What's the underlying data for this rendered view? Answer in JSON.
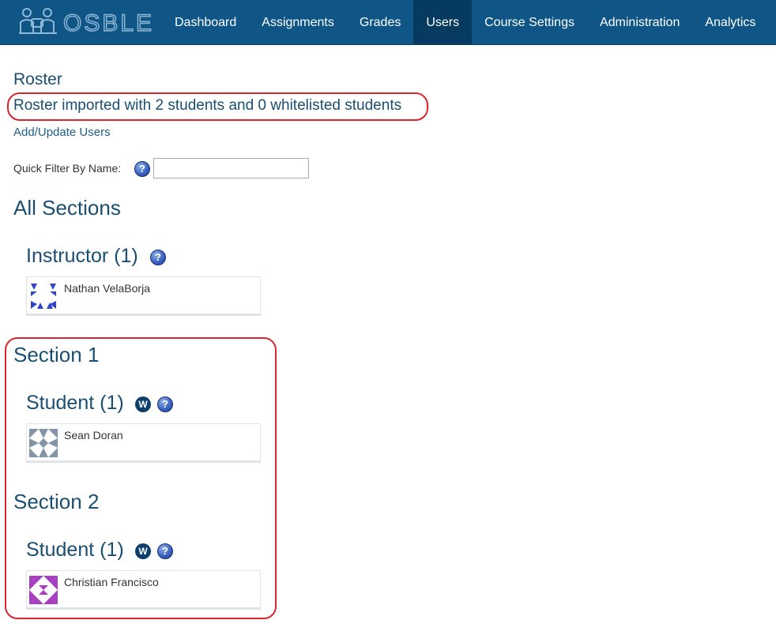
{
  "app": {
    "logo_text": "OSBLE"
  },
  "nav": {
    "items": [
      {
        "label": "Dashboard"
      },
      {
        "label": "Assignments"
      },
      {
        "label": "Grades"
      },
      {
        "label": "Users"
      },
      {
        "label": "Course Settings"
      },
      {
        "label": "Administration"
      },
      {
        "label": "Analytics"
      }
    ],
    "active": "Users"
  },
  "page": {
    "title": "Roster",
    "import_message": "Roster imported with 2 students and 0 whitelisted students",
    "add_link": "Add/Update Users",
    "filter": {
      "label": "Quick Filter By Name:",
      "value": ""
    },
    "all_sections_heading": "All Sections"
  },
  "instructor_group": {
    "heading": "Instructor (1)",
    "users": [
      {
        "name": "Nathan VelaBorja",
        "avatar_color": "#2f46c8"
      }
    ]
  },
  "sections": [
    {
      "heading": "Section 1",
      "group_heading": "Student (1)",
      "users": [
        {
          "name": "Sean Doran",
          "avatar_color": "#8294a8"
        }
      ]
    },
    {
      "heading": "Section 2",
      "group_heading": "Student (1)",
      "users": [
        {
          "name": "Christian Francisco",
          "avatar_color": "#a63fc0"
        }
      ]
    }
  ],
  "icons": {
    "help": "?",
    "whitelist": "W"
  },
  "colors": {
    "nav_bg": "#0f5686",
    "nav_active": "#063a5e",
    "heading": "#1a4f72",
    "highlight_ring": "#d9262e"
  }
}
